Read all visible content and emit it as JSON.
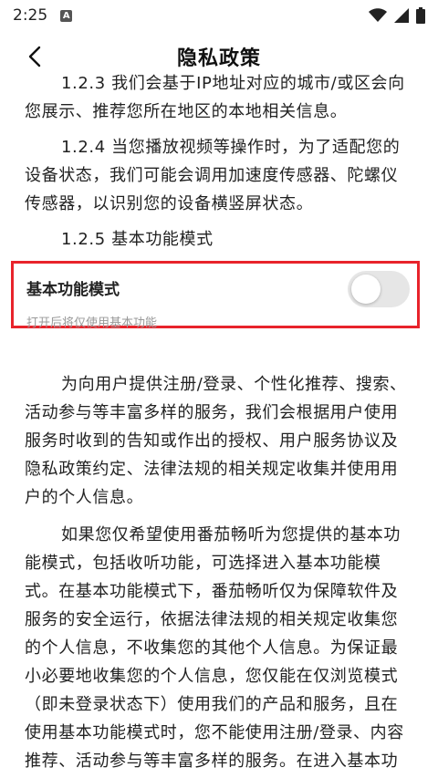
{
  "status": {
    "time": "2:25",
    "a_badge": "A"
  },
  "header": {
    "title": "隐私政策"
  },
  "content": {
    "p0": "1.2.3 我们会基于IP地址对应的城市/或区会向您展示、推荐您所在地区的本地相关信息。",
    "p1": "1.2.4 当您播放视频等操作时，为了适配您的设备状态，我们可能会调用加速度传感器、陀螺仪传感器，以识别您的设备横竖屏状态。",
    "p2": "1.2.5 基本功能模式",
    "toggle": {
      "label": "基本功能模式",
      "sub": "打开后将仅使用基本功能",
      "enabled": false
    },
    "p3": "为向用户提供注册/登录、个性化推荐、搜索、活动参与等丰富多样的服务，我们会根据用户使用服务时收到的告知或作出的授权、用户服务协议及隐私政策约定、法律法规的相关规定收集并使用用户的个人信息。",
    "p4": "如果您仅希望使用番茄畅听为您提供的基本功能模式，包括收听功能，可选择进入基本功能模式。在基本功能模式下，番茄畅听仅为保障软件及服务的安全运行，依据法律法规的相关规定收集您的个人信息，不收集您的其他个人信息。为保证最小必要地收集您的个人信息，您仅能在仅浏览模式（即未登录状态下）使用我们的产品和服务，且在使用基本功能模式时，您不能使用注册/登录、内容推荐、活动参与等丰富多样的服务。在进入基本功能模式前参加的活动将"
  }
}
